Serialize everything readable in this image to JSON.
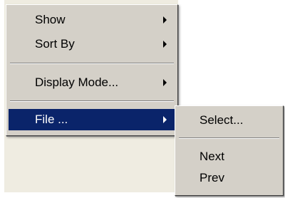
{
  "context_menu": {
    "items": [
      {
        "label": "Show",
        "has_submenu": true
      },
      {
        "label": "Sort By",
        "has_submenu": true
      },
      {
        "label": "Display Mode...",
        "has_submenu": true
      },
      {
        "label": "File ...",
        "has_submenu": true,
        "highlighted": true
      }
    ]
  },
  "file_submenu": {
    "items": [
      {
        "label": "Select..."
      },
      {
        "label": "Next"
      },
      {
        "label": "Prev"
      }
    ]
  },
  "colors": {
    "menu_face": "#d4d0c8",
    "highlight": "#0a246a",
    "highlight_text": "#ffffff",
    "background": "#efece1"
  }
}
